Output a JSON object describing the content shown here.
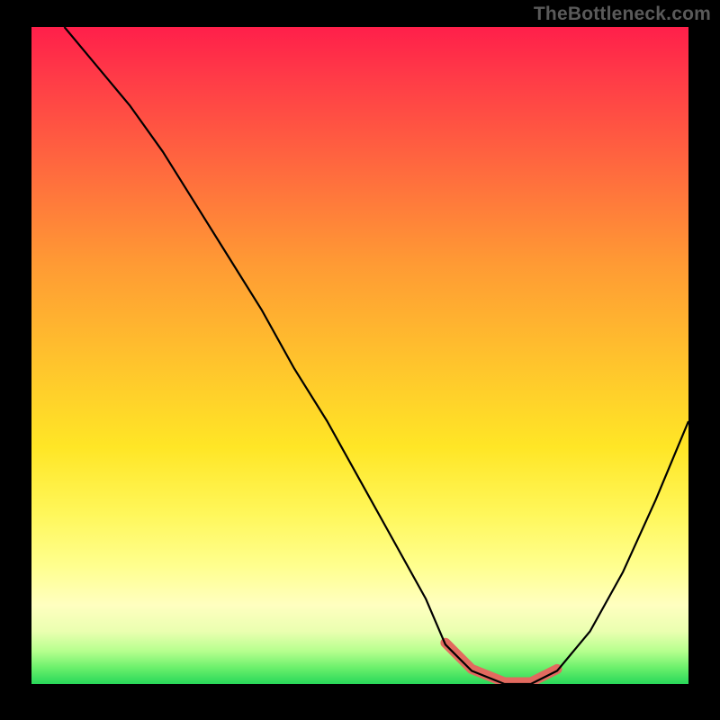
{
  "watermark": "TheBottleneck.com",
  "chart_data": {
    "type": "line",
    "title": "",
    "xlabel": "",
    "ylabel": "",
    "xlim": [
      0,
      100
    ],
    "ylim": [
      0,
      100
    ],
    "x": [
      5,
      10,
      15,
      20,
      25,
      30,
      35,
      40,
      45,
      50,
      55,
      60,
      63,
      67,
      72,
      76,
      80,
      85,
      90,
      95,
      100
    ],
    "values": [
      100,
      94,
      88,
      81,
      73,
      65,
      57,
      48,
      40,
      31,
      22,
      13,
      6,
      2,
      0,
      0,
      2,
      8,
      17,
      28,
      40
    ],
    "highlight_range_x": [
      63,
      80
    ],
    "gradient_colors": {
      "top": "#ff1f4a",
      "mid": "#ffe626",
      "bottom": "#28d85a"
    }
  }
}
